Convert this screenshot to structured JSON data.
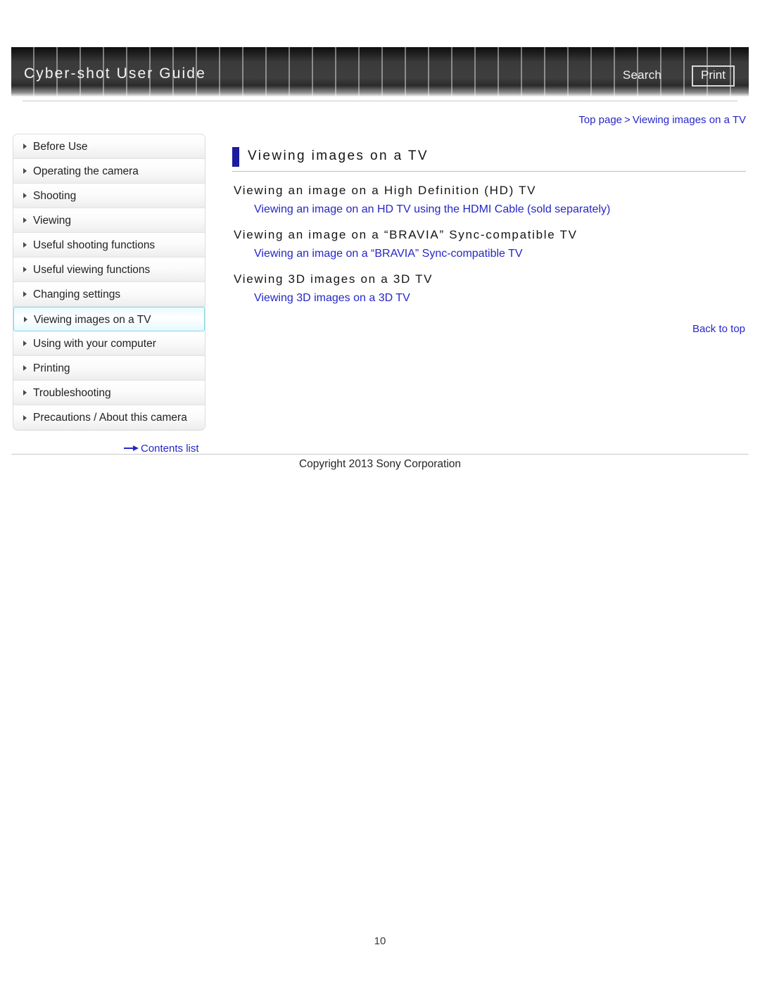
{
  "header": {
    "title": "Cyber-shot User Guide",
    "search_label": "Search",
    "print_label": "Print"
  },
  "breadcrumb": {
    "top_page": "Top page",
    "separator": ">",
    "current": "Viewing images on a TV"
  },
  "sidebar": {
    "items": [
      {
        "label": "Before Use",
        "active": false
      },
      {
        "label": "Operating the camera",
        "active": false
      },
      {
        "label": "Shooting",
        "active": false
      },
      {
        "label": "Viewing",
        "active": false
      },
      {
        "label": "Useful shooting functions",
        "active": false
      },
      {
        "label": "Useful viewing functions",
        "active": false
      },
      {
        "label": "Changing settings",
        "active": false
      },
      {
        "label": "Viewing images on a TV",
        "active": true
      },
      {
        "label": "Using with your computer",
        "active": false
      },
      {
        "label": "Printing",
        "active": false
      },
      {
        "label": "Troubleshooting",
        "active": false
      },
      {
        "label": "Precautions / About this camera",
        "active": false
      }
    ],
    "contents_list_label": "Contents list",
    "contents_list_icon": "arrow-right-icon"
  },
  "main": {
    "page_title": "Viewing images on a TV",
    "sections": [
      {
        "heading": "Viewing an image on a High Definition (HD) TV",
        "link": "Viewing an image on an HD TV using the HDMI Cable (sold separately)"
      },
      {
        "heading": "Viewing an image on a “BRAVIA” Sync-compatible TV",
        "link": "Viewing an image on a “BRAVIA” Sync-compatible TV"
      },
      {
        "heading": "Viewing 3D images on a 3D TV",
        "link": "Viewing 3D images on a 3D TV"
      }
    ],
    "back_to_top_label": "Back to top"
  },
  "footer": {
    "copyright": "Copyright 2013 Sony Corporation",
    "page_number": "10"
  },
  "colors": {
    "link_blue": "#2626c8",
    "title_accent": "#1c1c9e",
    "active_nav_border": "#7fd9ee",
    "header_dark": "#3a3a3a"
  }
}
